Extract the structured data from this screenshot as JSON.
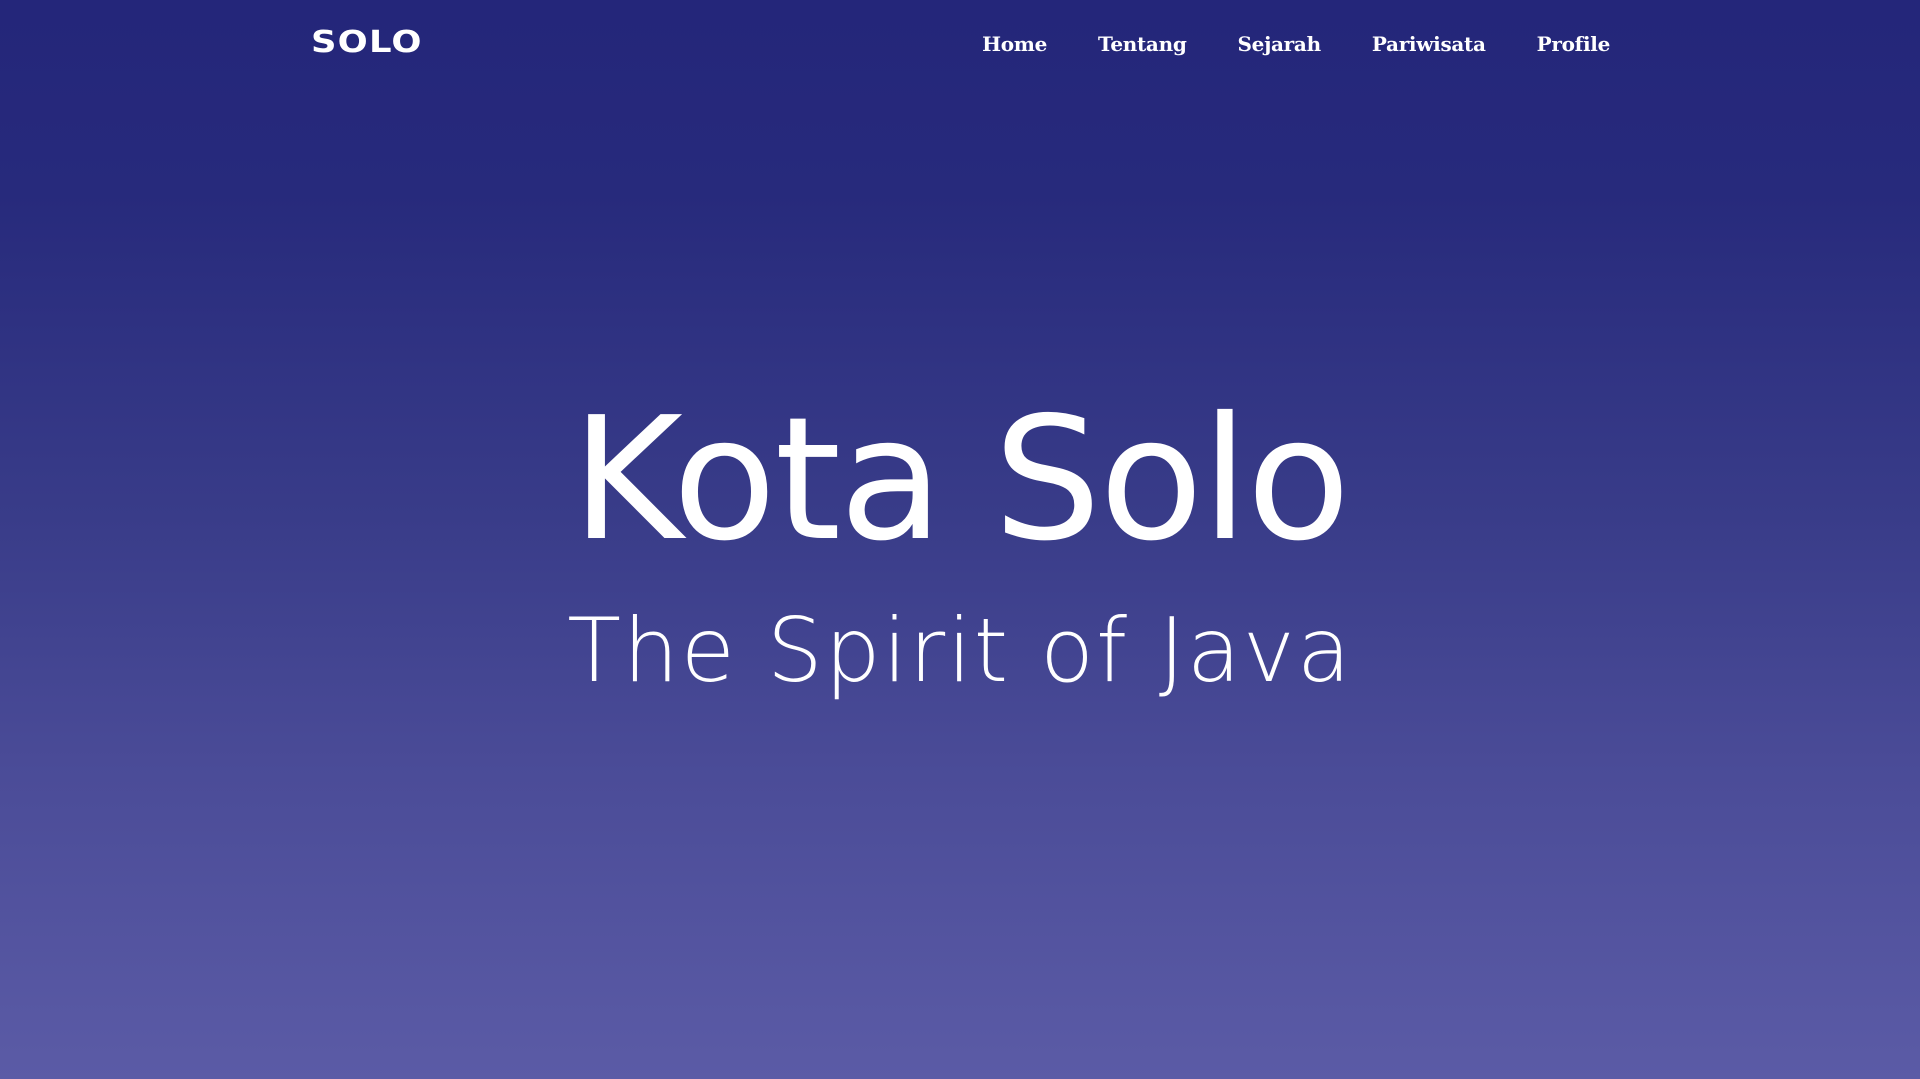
{
  "navbar": {
    "brand": "SOLO",
    "links": [
      {
        "label": "Home"
      },
      {
        "label": "Tentang"
      },
      {
        "label": "Sejarah"
      },
      {
        "label": "Pariwisata"
      },
      {
        "label": "Profile"
      }
    ]
  },
  "hero": {
    "title": "Kota Solo",
    "subtitle": "The Spirit of Java"
  },
  "colors": {
    "background_top": "#24267a",
    "background_bottom": "#5b5ba6",
    "text": "#ffffff"
  }
}
